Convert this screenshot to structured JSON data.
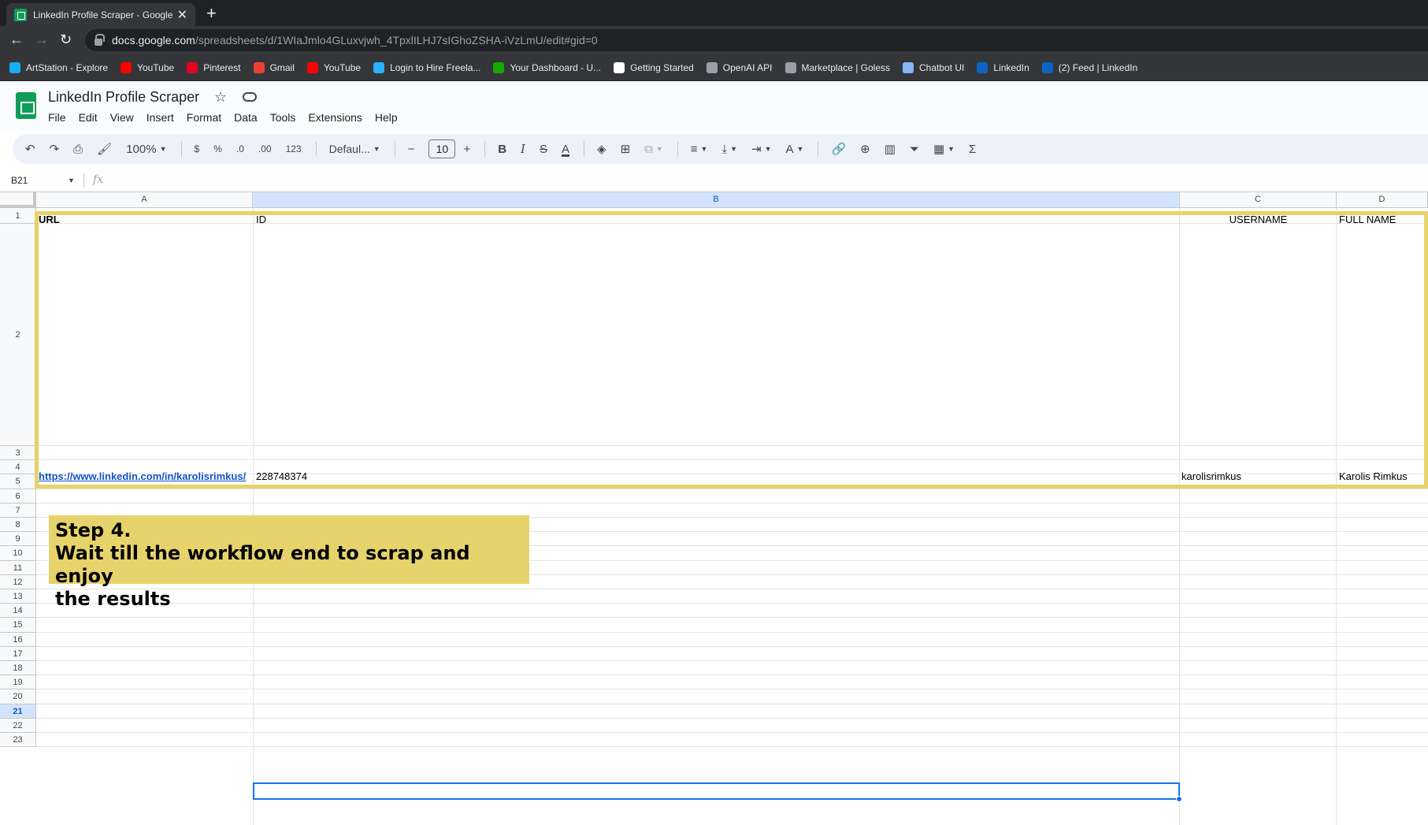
{
  "browser": {
    "tab_title": "LinkedIn Profile Scraper - Google",
    "url_domain": "docs.google.com",
    "url_path": "/spreadsheets/d/1WIaJmlo4GLuxvjwh_4TpxlILHJ7sIGhoZSHA-iVzLmU/edit#gid=0",
    "bookmarks": [
      {
        "label": "ArtStation - Explore",
        "icon": "artstation-icon",
        "color": "#13aff0"
      },
      {
        "label": "YouTube",
        "icon": "youtube-icon",
        "color": "#ff0000"
      },
      {
        "label": "Pinterest",
        "icon": "pinterest-icon",
        "color": "#e60023"
      },
      {
        "label": "Gmail",
        "icon": "gmail-icon",
        "color": "#ea4335"
      },
      {
        "label": "YouTube",
        "icon": "youtube-icon",
        "color": "#ff0000"
      },
      {
        "label": "Login to Hire Freela...",
        "icon": "freelancer-icon",
        "color": "#29b2fe"
      },
      {
        "label": "Your Dashboard - U...",
        "icon": "upwork-icon",
        "color": "#14a800"
      },
      {
        "label": "Getting Started",
        "icon": "notion-icon",
        "color": "#ffffff"
      },
      {
        "label": "OpenAI API",
        "icon": "openai-icon",
        "color": "#9aa0a6"
      },
      {
        "label": "Marketplace | Goless",
        "icon": "goless-icon",
        "color": "#9aa0a6"
      },
      {
        "label": "Chatbot UI",
        "icon": "chat-icon",
        "color": "#8ab4f8"
      },
      {
        "label": "LinkedIn",
        "icon": "linkedin-icon",
        "color": "#0a66c2"
      },
      {
        "label": "(2) Feed | LinkedIn",
        "icon": "linkedin-icon",
        "color": "#0a66c2"
      }
    ]
  },
  "doc": {
    "title": "LinkedIn Profile Scraper",
    "menu": [
      "File",
      "Edit",
      "View",
      "Insert",
      "Format",
      "Data",
      "Tools",
      "Extensions",
      "Help"
    ]
  },
  "toolbar": {
    "zoom": "100%",
    "currency": "$",
    "percent": "%",
    "dec_decrease": ".0",
    "dec_increase": ".00",
    "number_format": "123",
    "font": "Defaul...",
    "font_size": "10",
    "bold": "B",
    "italic": "I",
    "sum": "Σ"
  },
  "formula_bar": {
    "name_box": "B21",
    "fx": "fx"
  },
  "sheet": {
    "columns": [
      "A",
      "B",
      "C",
      "D"
    ],
    "rows": [
      "1",
      "2",
      "3",
      "4",
      "5",
      "6",
      "7",
      "8",
      "9",
      "10",
      "11",
      "12",
      "13",
      "14",
      "15",
      "16",
      "17",
      "18",
      "19",
      "20",
      "21",
      "22",
      "23"
    ],
    "headers": {
      "a": "URL",
      "b": "ID",
      "c": "USERNAME",
      "d": "FULL NAME"
    },
    "row2": {
      "a": "https://www.linkedin.com/in/karolisrimkus/",
      "b": "228748374",
      "c": "karolisrimkus",
      "d": "Karolis Rimkus"
    },
    "selected_cell": "B21"
  },
  "annotation": {
    "line1": "Step 4.",
    "line2": "Wait till the workflow end to scrap and enjoy",
    "line3": "the results",
    "color": "#e6d36b"
  }
}
